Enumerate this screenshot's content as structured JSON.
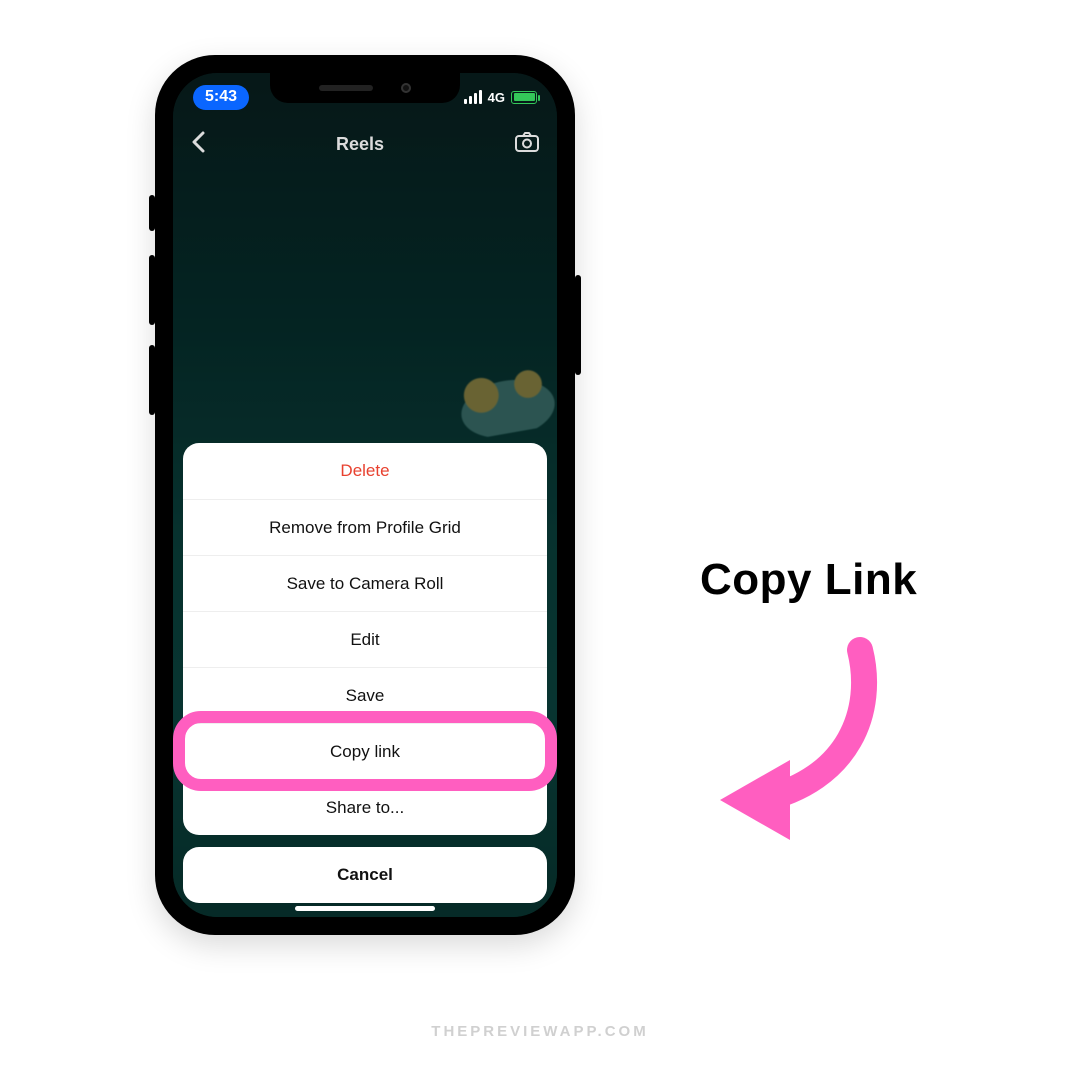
{
  "status": {
    "time": "5:43",
    "network": "4G"
  },
  "header": {
    "title": "Reels"
  },
  "action_sheet": {
    "items": [
      {
        "label": "Delete",
        "destructive": true
      },
      {
        "label": "Remove from Profile Grid",
        "destructive": false
      },
      {
        "label": "Save to Camera Roll",
        "destructive": false
      },
      {
        "label": "Edit",
        "destructive": false
      },
      {
        "label": "Save",
        "destructive": false
      },
      {
        "label": "Copy link",
        "destructive": false
      },
      {
        "label": "Share to...",
        "destructive": false
      }
    ],
    "cancel_label": "Cancel",
    "highlighted_index": 5
  },
  "annotation": {
    "text": "Copy Link",
    "arrow_color": "#ff5ec0"
  },
  "watermark": "THEPREVIEWAPP.COM"
}
